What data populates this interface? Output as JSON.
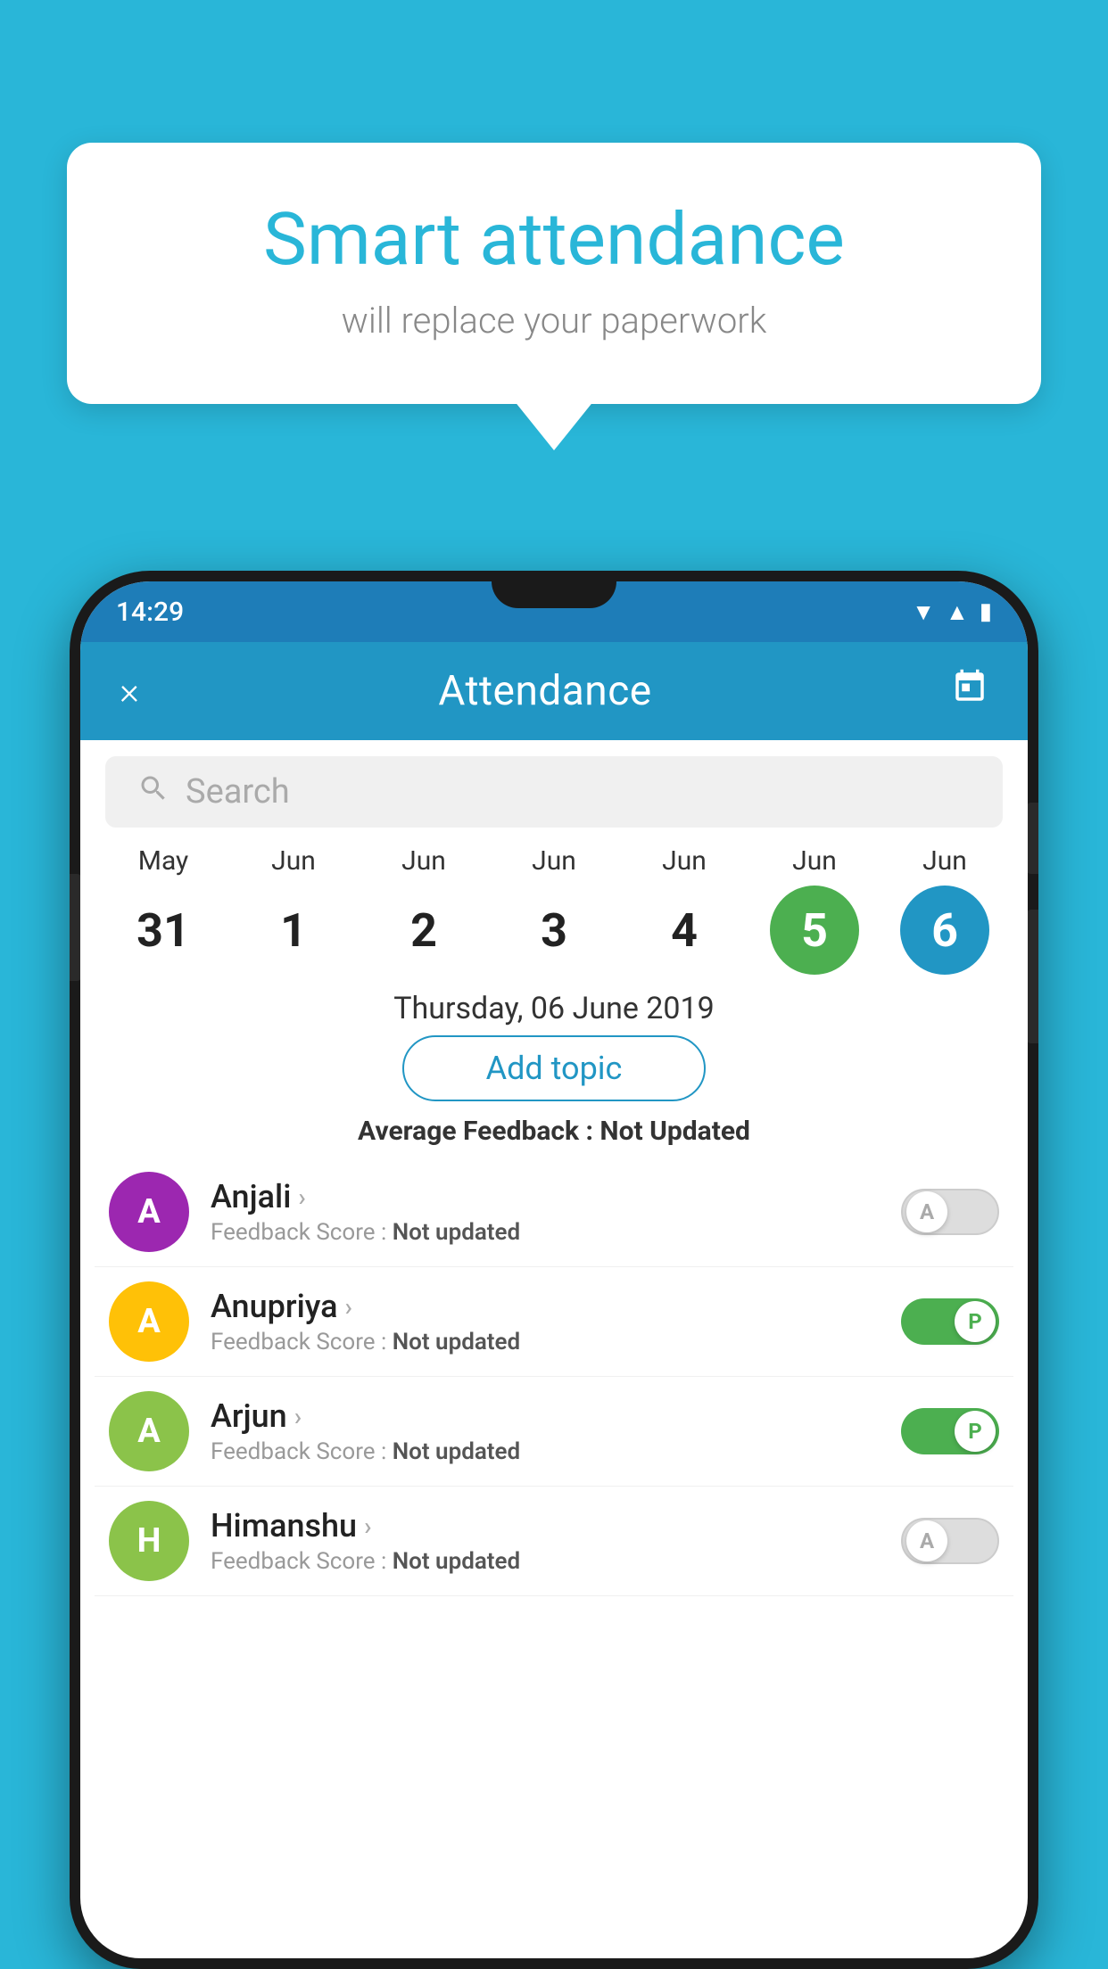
{
  "background_color": "#29b6d8",
  "bubble": {
    "title": "Smart attendance",
    "subtitle": "will replace your paperwork"
  },
  "status_bar": {
    "time": "14:29",
    "icons": [
      "wifi",
      "signal",
      "battery"
    ]
  },
  "header": {
    "title": "Attendance",
    "close_label": "×",
    "calendar_icon": "📅"
  },
  "search": {
    "placeholder": "Search"
  },
  "calendar": {
    "days": [
      {
        "month": "May",
        "date": "31",
        "state": "normal"
      },
      {
        "month": "Jun",
        "date": "1",
        "state": "normal"
      },
      {
        "month": "Jun",
        "date": "2",
        "state": "normal"
      },
      {
        "month": "Jun",
        "date": "3",
        "state": "normal"
      },
      {
        "month": "Jun",
        "date": "4",
        "state": "normal"
      },
      {
        "month": "Jun",
        "date": "5",
        "state": "today"
      },
      {
        "month": "Jun",
        "date": "6",
        "state": "selected"
      }
    ]
  },
  "selected_date_label": "Thursday, 06 June 2019",
  "add_topic_label": "Add topic",
  "avg_feedback_label": "Average Feedback :",
  "avg_feedback_value": "Not Updated",
  "students": [
    {
      "name": "Anjali",
      "avatar_letter": "A",
      "avatar_color": "#9c27b0",
      "feedback_label": "Feedback Score :",
      "feedback_value": "Not updated",
      "toggle_state": "off",
      "toggle_letter": "A"
    },
    {
      "name": "Anupriya",
      "avatar_letter": "A",
      "avatar_color": "#ffc107",
      "feedback_label": "Feedback Score :",
      "feedback_value": "Not updated",
      "toggle_state": "on",
      "toggle_letter": "P"
    },
    {
      "name": "Arjun",
      "avatar_letter": "A",
      "avatar_color": "#8bc34a",
      "feedback_label": "Feedback Score :",
      "feedback_value": "Not updated",
      "toggle_state": "on",
      "toggle_letter": "P"
    },
    {
      "name": "Himanshu",
      "avatar_letter": "H",
      "avatar_color": "#8bc34a",
      "feedback_label": "Feedback Score :",
      "feedback_value": "Not updated",
      "toggle_state": "off",
      "toggle_letter": "A"
    }
  ]
}
